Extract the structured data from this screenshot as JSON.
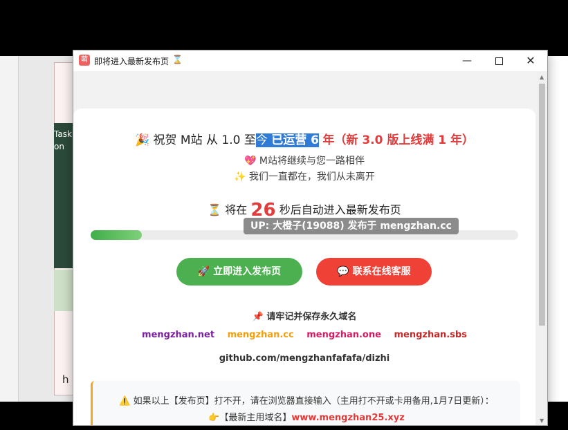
{
  "background": {
    "left_text_1": "Task",
    "left_text_2": "on",
    "left_text_3": "h"
  },
  "window": {
    "app_icon": "萌",
    "title": "即将进入最新发布页",
    "title_icon": "⌛",
    "minimize": "—",
    "close": "✕"
  },
  "content": {
    "headline_icon": "🎉",
    "headline_pre": "祝贺 M站 从 1.0 至",
    "headline_sel_a": "今",
    "headline_sel_b": "已运营 6",
    "headline_post": "年（新 3.0 版上线满 1 年）",
    "sub1": "💖  M站将继续与您一路相伴",
    "sub2": "✨  我们一直都在，我们从未离开",
    "countdown_icon": "⏳",
    "countdown_pre": "将在",
    "countdown_seconds": "26",
    "countdown_post": "秒后自动进入最新发布页",
    "tooltip": "UP: 大橙子(19088) 发布于 mengzhan.cc",
    "progress": 0.12,
    "btn_go": "🚀 立即进入发布页",
    "btn_service": "💬 联系在线客服",
    "domains_title": "📌 请牢记并保存永久域名",
    "domains": [
      "mengzhan.net",
      "mengzhan.cc",
      "mengzhan.one",
      "mengzhan.sbs"
    ],
    "github": "github.com/mengzhanfafafa/dizhi",
    "notice_1": "⚠️ 如果以上【发布页】打不开，请在浏览器直接输入（主用打不开或卡用备用,1月7日更新）：",
    "notice_2_pre": "👉【最新主用域名】",
    "notice_2_link": "www.mengzhan25.xyz"
  },
  "colors": {
    "accent_green": "#4caf50",
    "accent_red": "#ef4136",
    "selection_blue": "#2f7bd6"
  }
}
